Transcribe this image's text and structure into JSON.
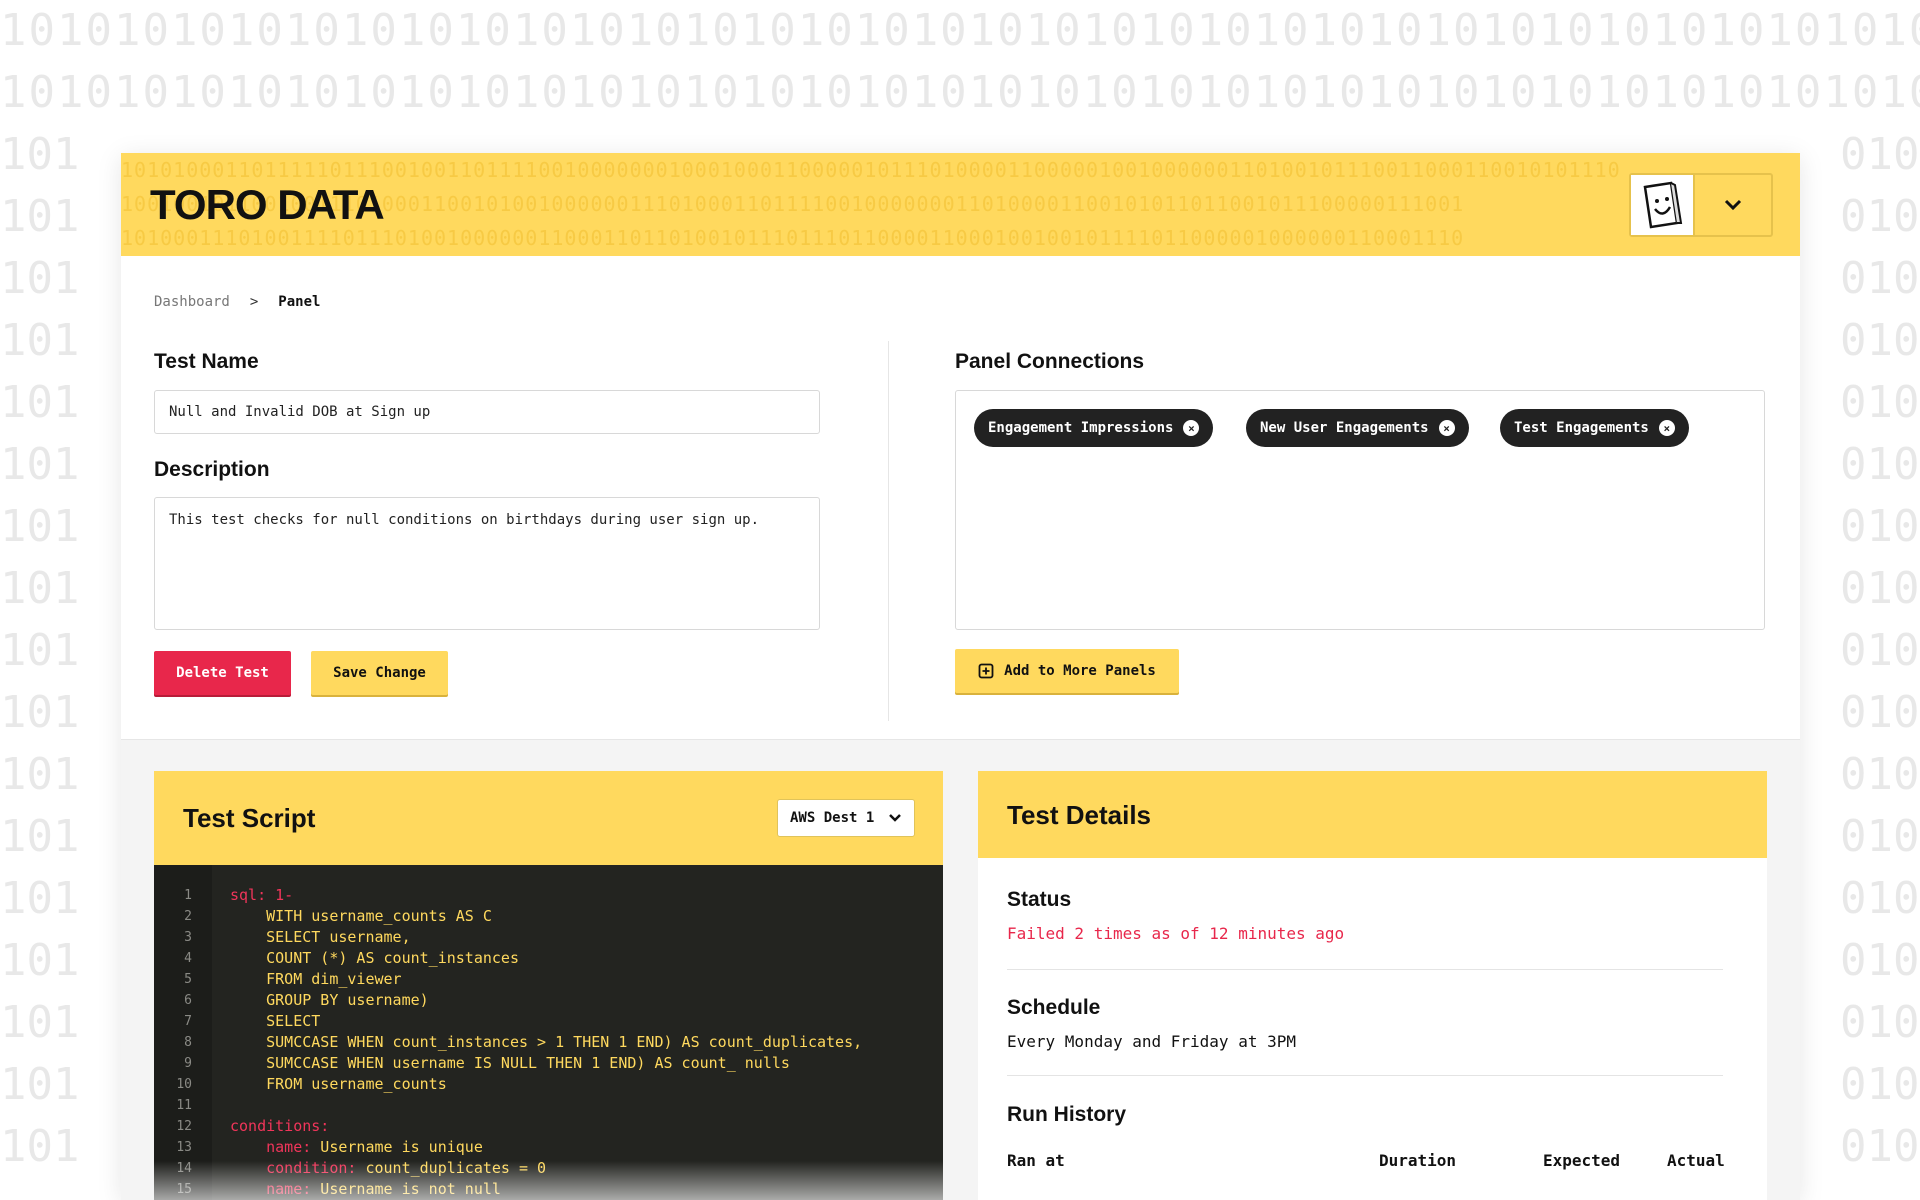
{
  "background_pattern": "10101010101010101010101010101010101010101010101010101010101010101010101010101010",
  "header_pattern_1": "1010100011011111011100100110111100100000001000100011000001011101000011000001001000000110100101110011000110010101110",
  "header_pattern_2": "1001001011001001110100011001010010000001110100011011110010000000110100001100101011011001011100000111001",
  "header_pattern_3": "1010001110100111101110100100000011000110110100101110111011000011000100100101111011000001000000110001110",
  "header": {
    "logo": "TORO DATA",
    "avatar_icon": "face-card-icon",
    "menu_icon": "chevron-down-icon"
  },
  "breadcrumb": {
    "items": [
      "Dashboard",
      "Panel"
    ],
    "separator": ">"
  },
  "form": {
    "test_name_label": "Test Name",
    "test_name_value": "Null and Invalid DOB at Sign up",
    "description_label": "Description",
    "description_value": "This test checks for null conditions on birthdays during user sign up.",
    "delete_label": "Delete Test",
    "save_label": "Save Change"
  },
  "connections": {
    "label": "Panel Connections",
    "chips": [
      {
        "label": "Engagement Impressions"
      },
      {
        "label": "New User Engagements"
      },
      {
        "label": "Test Engagements"
      }
    ],
    "add_label": "Add to More Panels"
  },
  "script": {
    "title": "Test Script",
    "destination": "AWS Dest 1",
    "line_numbers": [
      "1",
      "2",
      "3",
      "4",
      "5",
      "6",
      "7",
      "8",
      "9",
      "10",
      "11",
      "12",
      "13",
      "14",
      "15"
    ]
  },
  "details": {
    "title": "Test Details",
    "status_label": "Status",
    "status_value": "Failed 2 times as of 12 minutes ago",
    "schedule_label": "Schedule",
    "schedule_value": "Every Monday and Friday at 3PM",
    "run_history_label": "Run History",
    "columns": [
      "Ran at",
      "Duration",
      "Expected",
      "Actual"
    ]
  },
  "colors": {
    "accent_yellow": "#ffd95e",
    "danger_red": "#e8274b",
    "code_bg": "#232420"
  }
}
